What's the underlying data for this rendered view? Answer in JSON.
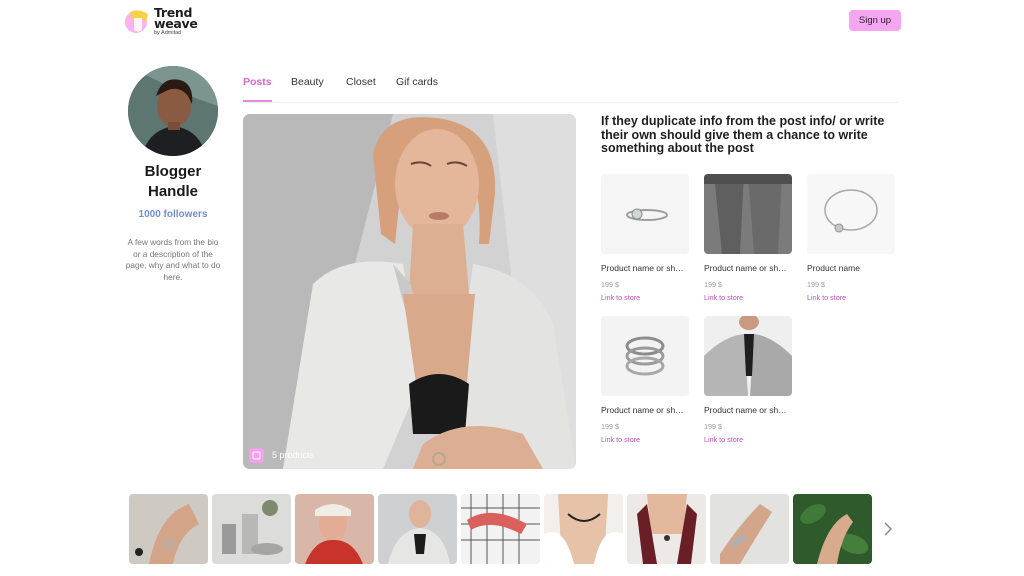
{
  "header": {
    "logo_line1": "Trend",
    "logo_line2": "weave",
    "logo_sub": "by Admitad",
    "signup_label": "Sign up"
  },
  "profile": {
    "name_line1": "Blogger",
    "name_line2": "Handle",
    "followers": "1000 followers",
    "bio": "A few words from the bio or a description of the page, why and what to do here."
  },
  "tabs": [
    {
      "label": "Posts",
      "active": true
    },
    {
      "label": "Beauty",
      "active": false
    },
    {
      "label": "Closet",
      "active": false
    },
    {
      "label": "Gif cards",
      "active": false
    }
  ],
  "post": {
    "products_count": "5 products",
    "text": "If they duplicate info from the post info/ or write their own should give them a chance to write something about the post"
  },
  "products": [
    {
      "name": "Product name or sh…",
      "price": "199 $",
      "link": "Link to store",
      "image": "ring-thin"
    },
    {
      "name": "Product name or sh…",
      "price": "199 $",
      "link": "Link to store",
      "image": "gray-trousers"
    },
    {
      "name": "Product name",
      "price": "199 $",
      "link": "Link to store",
      "image": "bangle-bracelet"
    },
    {
      "name": "Product name or sh…",
      "price": "199 $",
      "link": "Link to store",
      "image": "coil-ring"
    },
    {
      "name": "Product name or sh…",
      "price": "199 $",
      "link": "Link to store",
      "image": "gray-blazer"
    }
  ],
  "thumbnails": [
    "hand-rings",
    "jewelry-stand",
    "red-portrait",
    "blazer-look",
    "bracelets-grid",
    "choker-necklace",
    "burgundy-scarf",
    "hand-bracelet",
    "green-leaves-hand"
  ],
  "colors": {
    "accent": "#d36ad0",
    "button": "#f5a6f0",
    "followers": "#6f8ddc",
    "link": "#c24cc0"
  },
  "icons": {
    "logo": "trendweave-logo-icon",
    "badge": "shopping-tag-icon",
    "next": "chevron-right-icon"
  }
}
